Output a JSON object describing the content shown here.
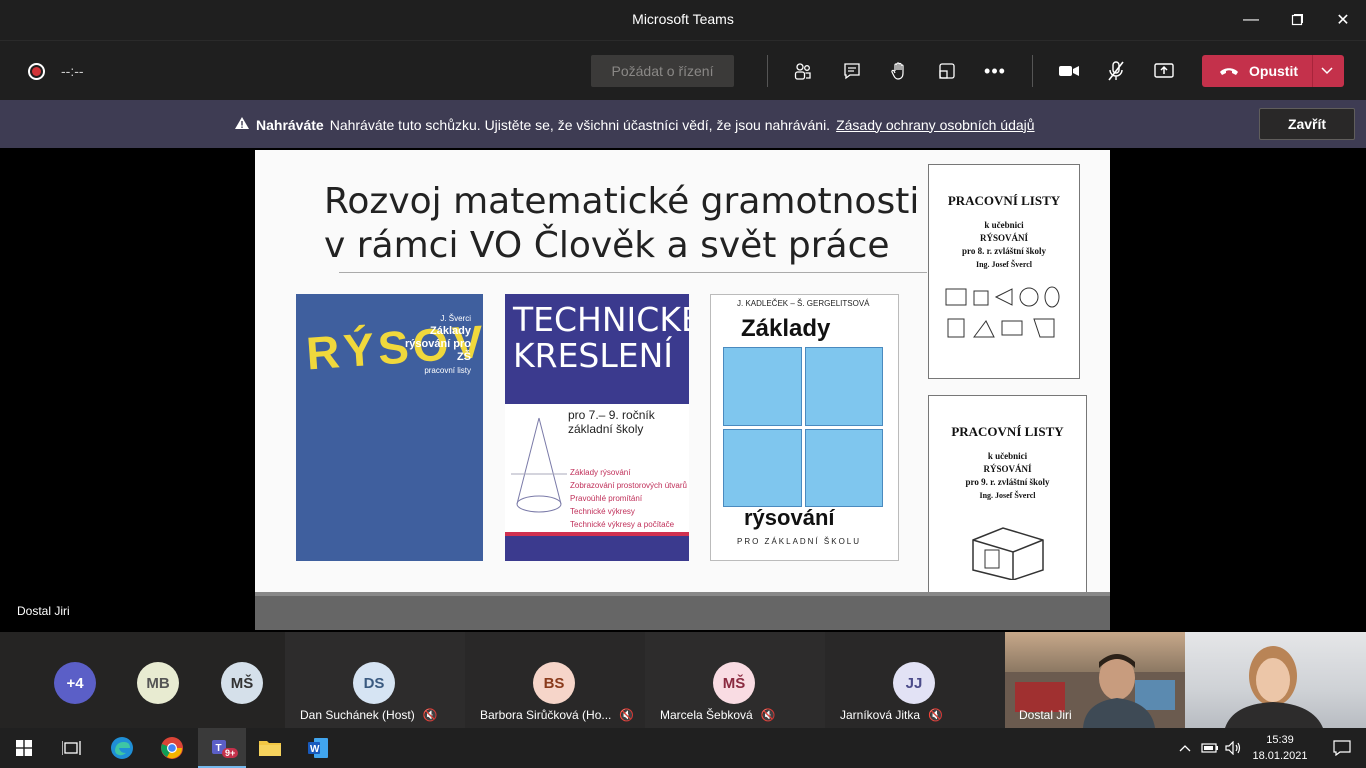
{
  "window": {
    "title": "Microsoft Teams"
  },
  "toolbar": {
    "timer": "--:--",
    "request_control": "Požádat o řízení",
    "leave_label": "Opustit"
  },
  "banner": {
    "bold": "Nahráváte",
    "message": "Nahráváte tuto schůzku. Ujistěte se, že všichni účastníci vědí, že jsou nahráváni.",
    "link": "Zásady ochrany osobních údajů",
    "close": "Zavřít"
  },
  "slide": {
    "title_line1": "Rozvoj matematické gramotnosti",
    "title_line2": "v rámci VO Člověk a svět práce",
    "book1": {
      "author": "J. Šverci",
      "title": "Základy rýsování pro ZŠ",
      "subtitle": "pracovní listy",
      "cover_word": "RÝSOVÁNÍ"
    },
    "book2": {
      "title": "TECHNICKÉ KRESLENÍ",
      "subtitle_line1": "pro 7.– 9. ročník",
      "subtitle_line2": "základní školy",
      "topics": [
        "Základy rýsování",
        "Zobrazování prostorových útvarů",
        "Pravoúhlé promítání",
        "Technické výkresy",
        "Technické výkresy a počítače"
      ]
    },
    "book3": {
      "authors": "J. KADLEČEK – Š. GERGELITSOVÁ",
      "title_top": "Základy",
      "title_bottom": "rýsování",
      "subtitle": "PRO ZÁKLADNÍ ŠKOLU"
    },
    "ws1": {
      "title": "PRACOVNÍ LISTY",
      "l1": "k učebnici",
      "l2": "RÝSOVÁNÍ",
      "l3": "pro 8. r. zvláštní školy",
      "l4": "Ing. Josef Švercl"
    },
    "ws2": {
      "title": "PRACOVNÍ LISTY",
      "l1": "k učebnici",
      "l2": "RÝSOVÁNÍ",
      "l3": "pro 9. r. zvláštní školy",
      "l4": "Ing. Josef Švercl"
    }
  },
  "presenter": {
    "name": "Dostal Jiri"
  },
  "participants": [
    {
      "initials": "+4",
      "name": ""
    },
    {
      "initials": "MB",
      "name": ""
    },
    {
      "initials": "MŠ",
      "name": ""
    },
    {
      "initials": "DS",
      "name": "Dan Suchánek (Host)"
    },
    {
      "initials": "BS",
      "name": "Barbora Sirůčková (Ho..."
    },
    {
      "initials": "MŠ",
      "name": "Marcela Šebková"
    },
    {
      "initials": "JJ",
      "name": "Jarníková Jitka"
    },
    {
      "initials": "",
      "name": "Dostal Jiri"
    }
  ],
  "colors": {
    "plus_avatar": "#5b5fc7",
    "mb_avatar": "#e8ebd1",
    "ms_avatar": "#d5e0ea",
    "ds_avatar": "#d6e4f3",
    "bs_avatar": "#f6d5c9",
    "ms2_avatar": "#f9dce3",
    "jj_avatar": "#e2e2f5",
    "leave": "#c4314b",
    "banner": "#3e3c53"
  },
  "taskbar": {
    "time": "15:39",
    "date": "18.01.2021",
    "teams_badge": "9+"
  }
}
